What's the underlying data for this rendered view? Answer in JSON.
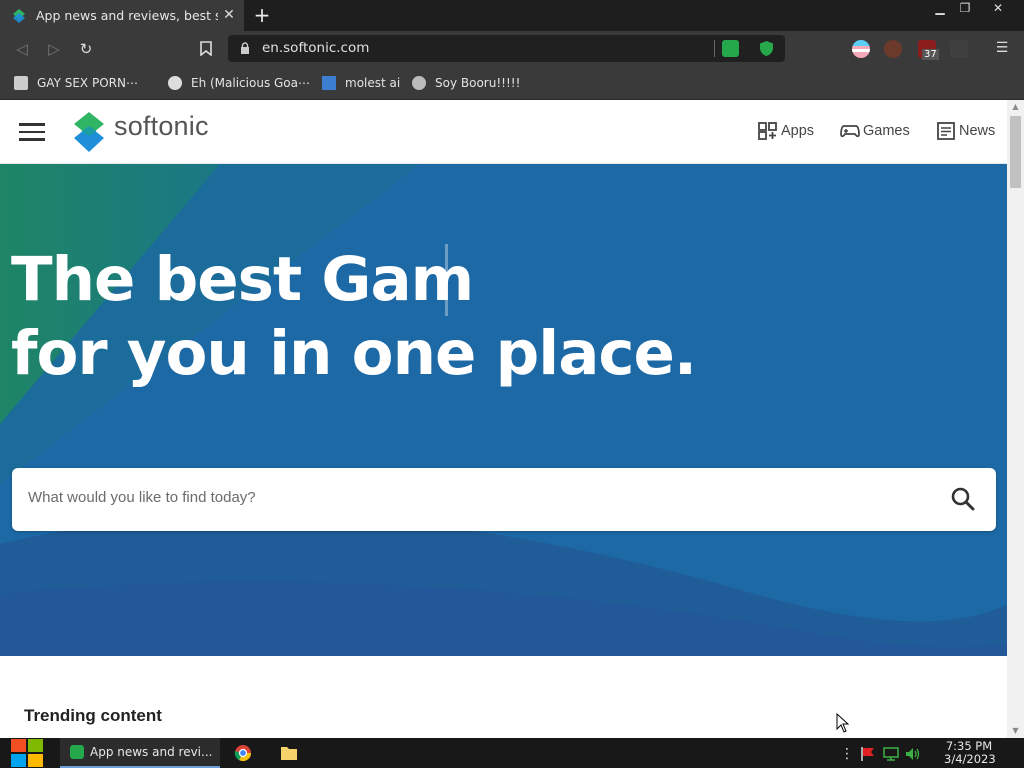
{
  "browser": {
    "tab": {
      "title": "App news and reviews, best sof",
      "close_icon": "close-icon"
    },
    "new_tab_label": "+",
    "window_controls": [
      "minimize-icon",
      "restore-icon",
      "close-icon"
    ],
    "url": "en.softonic.com",
    "bookmarks": [
      {
        "label": "GAY SEX PORN⋯",
        "icon": "bookmark-favicon-1"
      },
      {
        "label": "Eh (Malicious Goa⋯",
        "icon": "globe-icon"
      },
      {
        "label": "molest ai",
        "icon": "bookmark-favicon-3"
      },
      {
        "label": "Soy Booru!!!!!",
        "icon": "bookmark-favicon-4"
      }
    ],
    "extension_badge": "37"
  },
  "site": {
    "logo_text": "softonic",
    "nav": [
      {
        "label": "Apps",
        "icon": "apps-grid-icon"
      },
      {
        "label": "Games",
        "icon": "gamepad-icon"
      },
      {
        "label": "News",
        "icon": "news-icon"
      }
    ],
    "hero": {
      "line1": "The best Gam",
      "line2": "for you in one place."
    },
    "search": {
      "placeholder": "What would you like to find today?"
    },
    "trending_title": "Trending content"
  },
  "taskbar": {
    "task_label": "App news and revi...",
    "clock_time": "7:35 PM",
    "clock_date": "3/4/2023"
  },
  "colors": {
    "hero_blue": "#1d66a4",
    "brand_green": "#2fb563",
    "brand_blue": "#1e8fd8"
  }
}
